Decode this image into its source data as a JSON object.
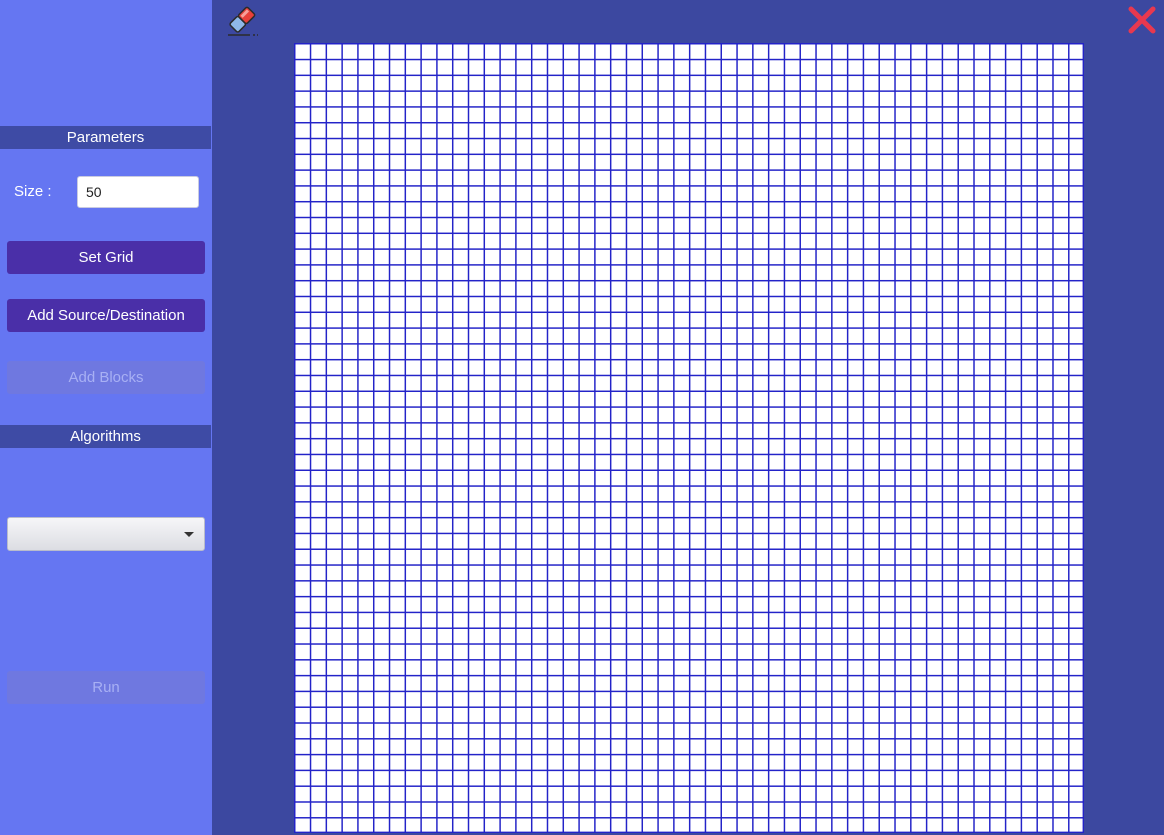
{
  "sidebar": {
    "parameters_header": "Parameters",
    "size_label": "Size :",
    "size_value": "50",
    "set_grid_label": "Set Grid",
    "add_source_destination_label": "Add Source/Destination",
    "add_blocks_label": "Add Blocks",
    "algorithms_header": "Algorithms",
    "algorithm_selected": "",
    "run_label": "Run"
  },
  "grid": {
    "size": 50
  },
  "icons": {
    "eraser": "eraser-icon",
    "close": "close-icon"
  },
  "colors": {
    "sidebar_bg": "#6576f2",
    "main_bg": "#3c48a0",
    "header_bg": "#3e4ba5",
    "button_active": "#4a2fa8",
    "button_disabled": "#6f78e0",
    "grid_line": "#2323c8",
    "close_red": "#e8384f"
  }
}
